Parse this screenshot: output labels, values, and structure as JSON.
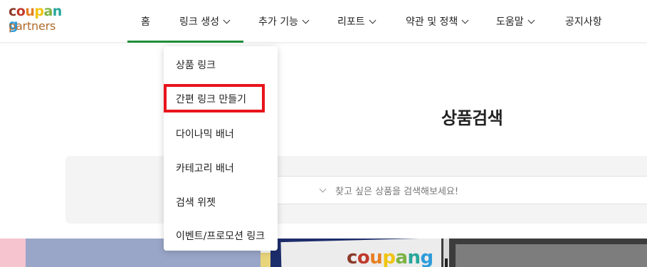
{
  "logo": {
    "word": [
      "c",
      "o",
      "u",
      "p",
      "a",
      "n",
      "g"
    ],
    "word_colors": [
      "#8b3a2b",
      "#c0392b",
      "#e67e22",
      "#f1c40f",
      "#7cb342",
      "#26a69a",
      "#2d9cdb"
    ],
    "sub": "partners"
  },
  "nav": {
    "items": [
      {
        "label": "홈",
        "has_dropdown": false
      },
      {
        "label": "링크 생성",
        "has_dropdown": true
      },
      {
        "label": "추가 기능",
        "has_dropdown": true
      },
      {
        "label": "리포트",
        "has_dropdown": true
      },
      {
        "label": "약관 및 정책",
        "has_dropdown": true
      },
      {
        "label": "도움말",
        "has_dropdown": true
      },
      {
        "label": "공지사항",
        "has_dropdown": false
      }
    ],
    "active_color": "#1f8e3a"
  },
  "dropdown": {
    "items": [
      {
        "label": "상품 링크"
      },
      {
        "label": "간편 링크 만들기",
        "highlighted": true
      },
      {
        "label": "다이나믹 배너"
      },
      {
        "label": "카테고리 배너"
      },
      {
        "label": "검색 위젯"
      },
      {
        "label": "이벤트/프로모션 링크"
      }
    ],
    "highlight_color": "#e8141c"
  },
  "main": {
    "title": "상품검색",
    "search_placeholder": "찾고 싶은 상품을 검색해보세요!"
  },
  "banner": {
    "logo_word": [
      "c",
      "o",
      "u",
      "p",
      "a",
      "n",
      "g"
    ],
    "logo_colors": [
      "#8b3a2b",
      "#c0392b",
      "#e67e22",
      "#f1c40f",
      "#7cb342",
      "#26a69a",
      "#2d9cdb"
    ]
  }
}
